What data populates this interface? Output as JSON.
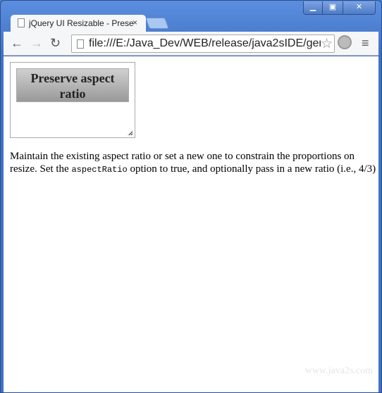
{
  "window": {
    "controls": [
      "minimize",
      "maximize",
      "close"
    ]
  },
  "tab": {
    "title": "jQuery UI Resizable - Prese",
    "close": "×"
  },
  "toolbar": {
    "url": "file:///E:/Java_Dev/WEB/release/java2sIDE/gen"
  },
  "page": {
    "box_title": "Preserve aspect ratio",
    "desc_a": "Maintain the existing aspect ratio or set a new one to constrain the proportions on resize. Set the ",
    "desc_code": "aspectRatio",
    "desc_b": " option to true, and optionally pass in a new ratio (i.e., 4/3)",
    "watermark": "www.java2s.com"
  }
}
